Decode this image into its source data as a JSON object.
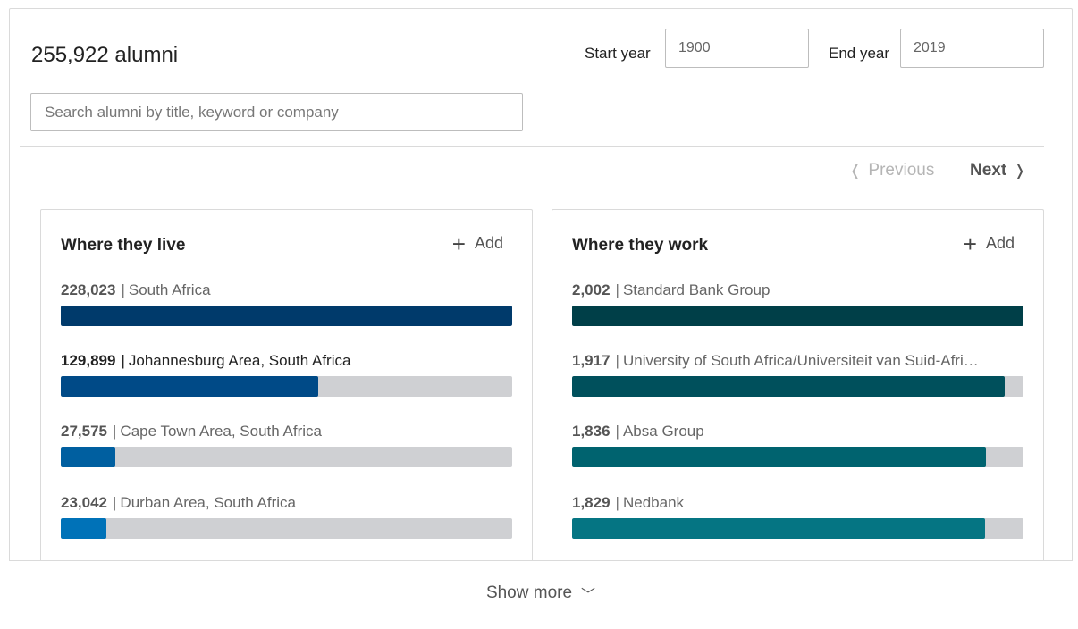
{
  "header": {
    "count_title": "255,922 alumni",
    "start_year_label": "Start year",
    "start_year_value": "1900",
    "end_year_label": "End year",
    "end_year_value": "2019",
    "search_placeholder": "Search alumni by title, keyword or company"
  },
  "pager": {
    "prev_label": "Previous",
    "next_label": "Next",
    "prev_icon": "chevron-left-icon",
    "next_icon": "chevron-right-icon"
  },
  "cards": [
    {
      "title": "Where they live",
      "add_label": "Add",
      "items": [
        {
          "count": "228,023",
          "label": "South Africa",
          "fraction": 1.0,
          "color": "#003a6b"
        },
        {
          "count": "129,899",
          "label": "Johannesburg Area, South Africa",
          "fraction": 0.57,
          "color": "#004a87"
        },
        {
          "count": "27,575",
          "label": "Cape Town Area, South Africa",
          "fraction": 0.121,
          "color": "#005fa0"
        },
        {
          "count": "23,042",
          "label": "Durban Area, South Africa",
          "fraction": 0.101,
          "color": "#0072b8"
        }
      ]
    },
    {
      "title": "Where they work",
      "add_label": "Add",
      "items": [
        {
          "count": "2,002",
          "label": "Standard Bank Group",
          "fraction": 1.0,
          "color": "#003f48"
        },
        {
          "count": "1,917",
          "label": "University of South Africa/Universiteit van Suid-Afri…",
          "fraction": 0.958,
          "color": "#00505c"
        },
        {
          "count": "1,836",
          "label": "Absa Group",
          "fraction": 0.917,
          "color": "#00636f"
        },
        {
          "count": "1,829",
          "label": "Nedbank",
          "fraction": 0.914,
          "color": "#057583"
        }
      ]
    }
  ],
  "footer": {
    "show_more_label": "Show more",
    "show_more_icon": "chevron-down-icon"
  }
}
